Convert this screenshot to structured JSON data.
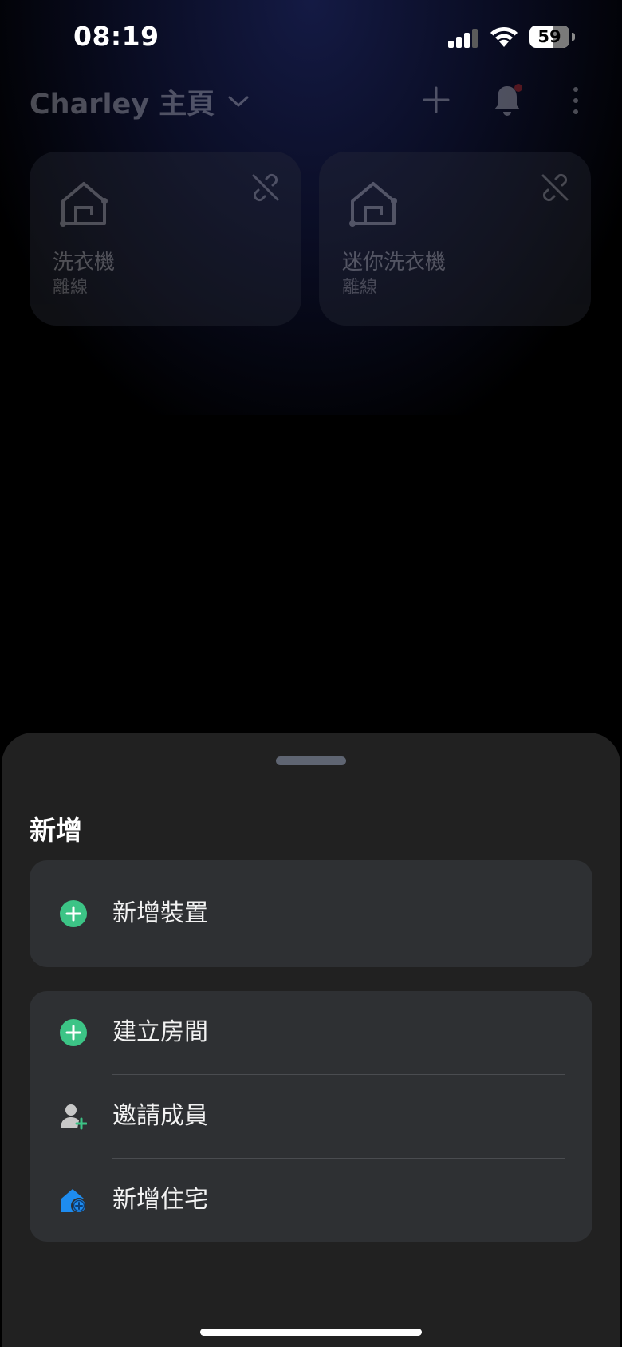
{
  "status_bar": {
    "time": "08:19",
    "battery": "59"
  },
  "home": {
    "title": "Charley 主頁",
    "has_notification": true,
    "devices": [
      {
        "name": "洗衣機",
        "status": "離線"
      },
      {
        "name": "迷你洗衣機",
        "status": "離線"
      }
    ]
  },
  "sheet": {
    "title": "新增",
    "groups": [
      {
        "items": [
          {
            "label": "新增裝置",
            "icon": "plus-circle-icon"
          }
        ]
      },
      {
        "items": [
          {
            "label": "建立房間",
            "icon": "plus-circle-icon"
          },
          {
            "label": "邀請成員",
            "icon": "person-add-icon"
          },
          {
            "label": "新增住宅",
            "icon": "house-add-icon"
          }
        ]
      }
    ]
  },
  "colors": {
    "accent_green": "#3cc486",
    "house_blue": "#1e8cf0",
    "notification_red": "#e0312b"
  }
}
